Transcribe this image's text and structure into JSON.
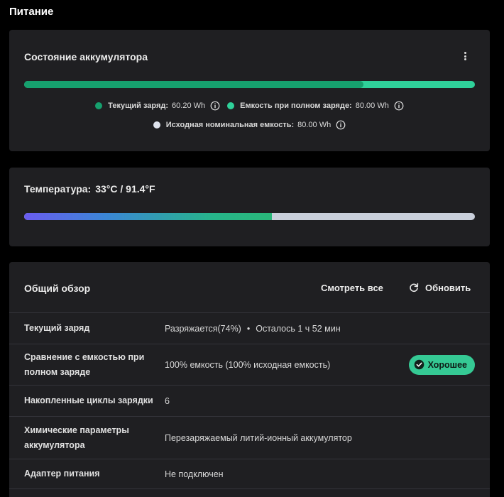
{
  "page": {
    "title": "Питание"
  },
  "battery": {
    "title": "Состояние аккумулятора",
    "menu_icon": "kebab-menu-icon",
    "charge_fraction": 0.7525,
    "colors": {
      "current": "#16a06e",
      "full": "#2fd19a",
      "design": "#dfe3ee",
      "track": "#c7cdd9"
    },
    "legend": {
      "current": {
        "label": "Текущий заряд:",
        "value": "60.20 Wh"
      },
      "full": {
        "label": "Емкость при полном заряде:",
        "value": "80.00 Wh"
      },
      "design": {
        "label": "Исходная номинальная емкость:",
        "value": "80.00 Wh"
      }
    }
  },
  "temperature": {
    "label": "Температура:",
    "value": "33°C / 91.4°F",
    "level_fraction": 0.549
  },
  "overview": {
    "title": "Общий обзор",
    "see_all": "Смотреть все",
    "refresh": "Обновить",
    "rows": [
      {
        "label": "Текущий заряд",
        "value_main": "Разряжается(74%)",
        "separator": "•",
        "value_extra": "Осталось 1 ч 52 мин"
      },
      {
        "label": "Сравнение с емкостью при полном заряде",
        "value": "100% емкость (100% исходная емкость)",
        "badge": "Хорошее",
        "badge_color": "#35c994"
      },
      {
        "label": "Накопленные циклы зарядки",
        "value": "6"
      },
      {
        "label": "Химические параметры аккумулятора",
        "value": "Перезаряжаемый литий-ионный аккумулятор"
      },
      {
        "label": "Адаптер питания",
        "value": "Не подключен"
      }
    ]
  }
}
